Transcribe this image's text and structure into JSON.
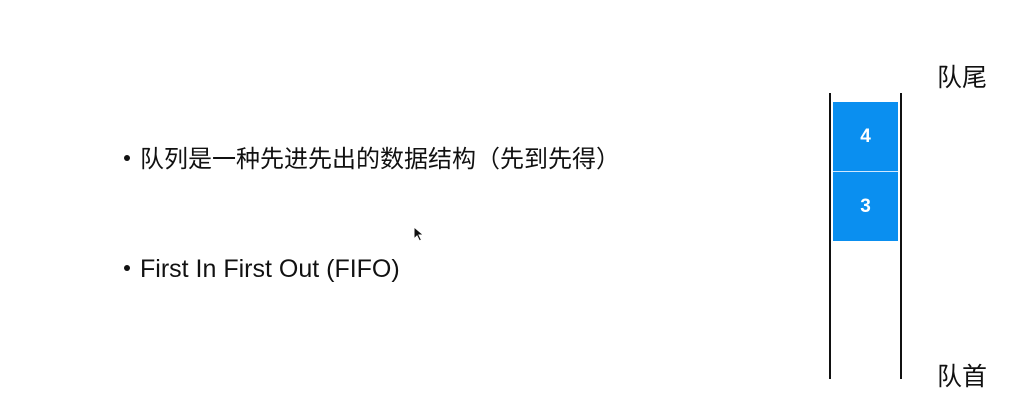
{
  "bullets": [
    "队列是一种先进先出的数据结构（先到先得）",
    "First In First Out (FIFO)"
  ],
  "queue": {
    "tail_label": "队尾",
    "head_label": "队首",
    "items": [
      "4",
      "3"
    ],
    "fill_color": "#0a8ff0"
  }
}
